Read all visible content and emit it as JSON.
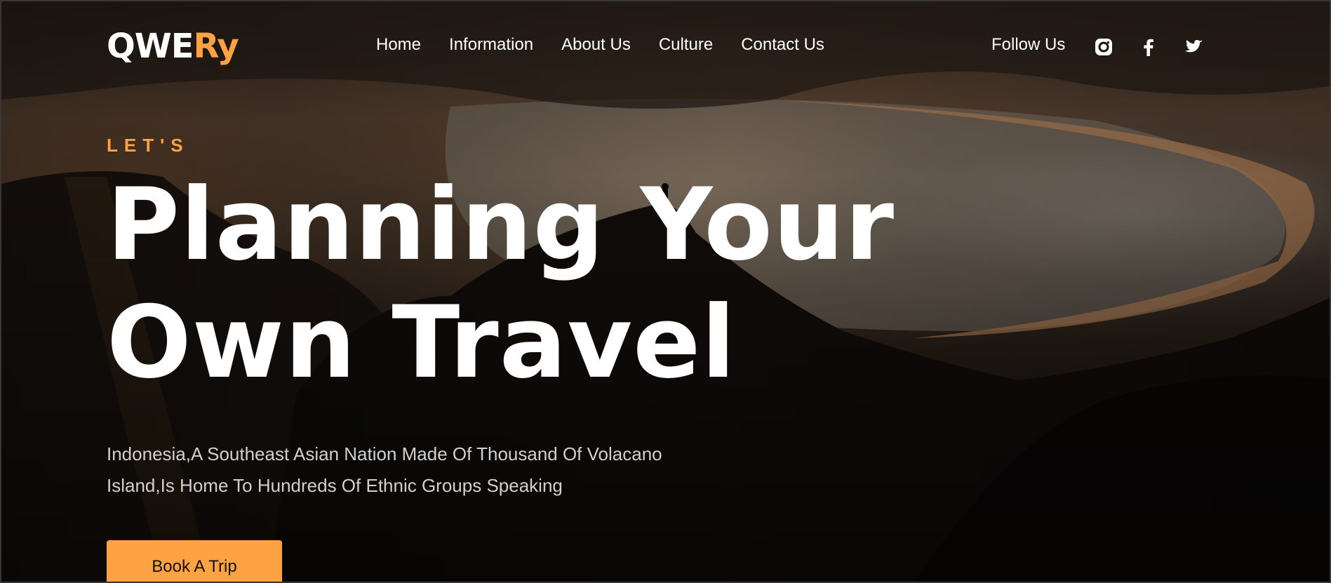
{
  "logo": {
    "primary": "QWE",
    "accent": "Ry"
  },
  "nav": {
    "items": [
      {
        "label": "Home"
      },
      {
        "label": "Information"
      },
      {
        "label": "About Us"
      },
      {
        "label": "Culture"
      },
      {
        "label": "Contact Us"
      }
    ]
  },
  "social": {
    "label": "Follow Us",
    "icons": [
      "instagram-icon",
      "facebook-icon",
      "twitter-icon"
    ]
  },
  "hero": {
    "eyebrow": "LET'S",
    "headline_line1": "Planning Your",
    "headline_line2": "Own Travel",
    "description": "Indonesia,A Southeast Asian Nation Made Of Thousand Of Volacano Island,Is Home To Hundreds Of Ethnic Groups Speaking",
    "cta_label": "Book A Trip"
  },
  "colors": {
    "accent": "#ffa243",
    "text": "#ffffff",
    "muted_text": "#d2d0cf"
  }
}
